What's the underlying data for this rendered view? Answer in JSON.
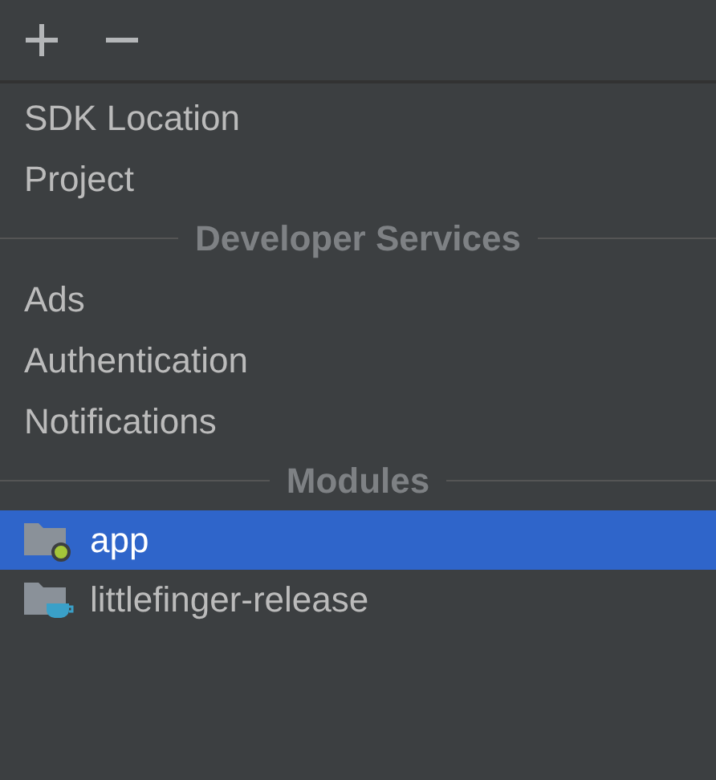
{
  "rows": [
    {
      "kind": "item",
      "label": "SDK Location"
    },
    {
      "kind": "item",
      "label": "Project"
    },
    {
      "kind": "header",
      "label": "Developer Services"
    },
    {
      "kind": "item",
      "label": "Ads"
    },
    {
      "kind": "item",
      "label": "Authentication"
    },
    {
      "kind": "item",
      "label": "Notifications"
    },
    {
      "kind": "header",
      "label": "Modules"
    },
    {
      "kind": "app-module",
      "label": "app",
      "selected": true
    },
    {
      "kind": "library-module",
      "label": "littlefinger-release",
      "selected": false
    }
  ]
}
